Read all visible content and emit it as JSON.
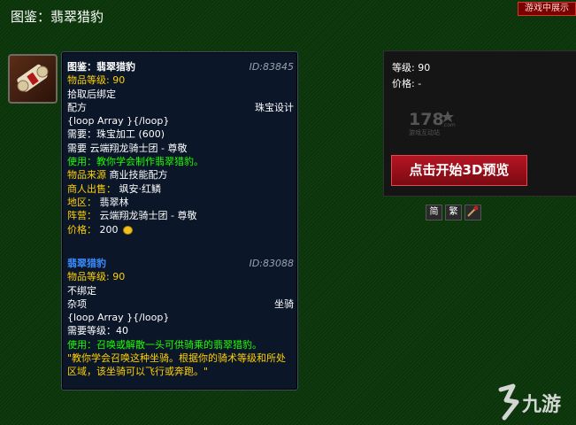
{
  "page": {
    "title": "图鉴：翡翠猎豹",
    "ingame_badge": "游戏中展示"
  },
  "tooltip1": {
    "name": "图鉴：翡翠猎豹",
    "id": "ID:83845",
    "item_level": "物品等级: 90",
    "bind": "拾取后绑定",
    "type": "配方",
    "subtype": "珠宝设计",
    "loop": "{loop Array }{/loop}",
    "req_skill": "需要：珠宝加工 (600)",
    "req_rep": "需要 云端翔龙骑士团 - 尊敬",
    "use": "使用：教你学会制作翡翠猎豹。",
    "source_label": "物品来源",
    "source_value": "商业技能配方",
    "vendor_label": "商人出售：",
    "vendor_value": "飒安·红鳞",
    "zone_label": "地区：",
    "zone_value": "翡翠林",
    "faction_label": "阵营：",
    "faction_value": "云端翔龙骑士团 - 尊敬",
    "price_label": "价格：",
    "price_value": "200"
  },
  "tooltip2": {
    "name": "翡翠猎豹",
    "id": "ID:83088",
    "item_level": "物品等级: 90",
    "bind": "不绑定",
    "type": "杂项",
    "subtype": "坐骑",
    "loop": "{loop Array }{/loop}",
    "req_level": "需要等级：40",
    "use": "使用：召唤或解散一头可供骑乘的翡翠猎豹。",
    "flavor": "\"教你学会召唤这种坐骑。根据你的骑术等级和所处区域，该坐骑可以飞行或奔跑。\""
  },
  "preview": {
    "level": "等级: 90",
    "price": "价格: -",
    "logo_number": "178",
    "logo_dotcom": ".com",
    "logo_sub": "游戏互动站",
    "button": "点击开始3D预览",
    "btn_simplified": "简",
    "btn_traditional": "繁"
  },
  "watermark": {
    "text": "九游"
  },
  "colors": {
    "gold": "#ffd100",
    "green": "#1eff00",
    "blue": "#3a8cff",
    "background": "#0e3a0e"
  }
}
